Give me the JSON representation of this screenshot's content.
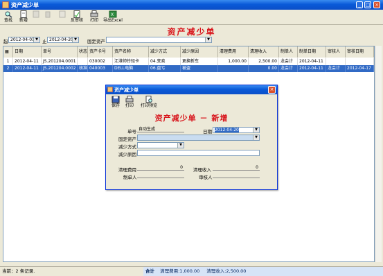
{
  "window": {
    "title": "资产减少单"
  },
  "toolbar": {
    "buttons": [
      {
        "label": "查找"
      },
      {
        "label": "新增"
      },
      {
        "label": ""
      },
      {
        "label": ""
      },
      {
        "label": ""
      },
      {
        "label": "反审核"
      },
      {
        "label": "打印"
      },
      {
        "label": "导出Excel"
      }
    ]
  },
  "report": {
    "title": "资产减少单"
  },
  "filters": {
    "start_label": "起",
    "start_value": "2012-04-01",
    "end_label": "止",
    "end_value": "2012-04-20",
    "asset_label": "固定资产",
    "asset_value": ""
  },
  "grid": {
    "columns": [
      "",
      "日期",
      "单号",
      "状态",
      "资产卡号",
      "资产名称",
      "减少方式",
      "减少原因",
      "清理费用",
      "清理收入",
      "制单人",
      "制单日期",
      "审核人",
      "审核日期"
    ],
    "rows": [
      [
        "1",
        "2012-04-11",
        "JS.201204.0001",
        "",
        "030002",
        "江淮帅铃轻卡",
        "04.变卖",
        "更换新车",
        "1,000.00",
        "2,500.00",
        "龙会计",
        "2012-04-11",
        "",
        ""
      ],
      [
        "2",
        "2012-04-11",
        "JS.201204.0002",
        "核准",
        "040003",
        "DELL电脑",
        "06.盘亏",
        "被盗",
        "",
        "0.00",
        "龙会计",
        "2012-04-11",
        "龙会计",
        "2012-04-17"
      ]
    ]
  },
  "status": {
    "left": "当前：2 条记录.",
    "total_label": "合计",
    "cost": "清理费用:1,000.00",
    "income": "清理收入:2,500.00"
  },
  "dialog": {
    "title": "资产减少单",
    "toolbar": [
      {
        "label": "保存"
      },
      {
        "label": "打印"
      },
      {
        "label": "打印预览"
      }
    ],
    "heading": "资产减少单 － 新增",
    "fields": {
      "no_label": "单号",
      "no_value": "自动生成",
      "date_label": "日期",
      "date_value": "2012-04-20",
      "asset_label": "固定资产",
      "asset_value": "",
      "method_label": "减少方式",
      "method_value": "",
      "reason_label": "减少原因",
      "reason_value": "",
      "cost_label": "清理费用",
      "cost_value": "0",
      "income_label": "清理收入",
      "income_value": "0",
      "maker_label": "制单人",
      "maker_value": "",
      "auditor_label": "审核人",
      "auditor_value": ""
    }
  }
}
